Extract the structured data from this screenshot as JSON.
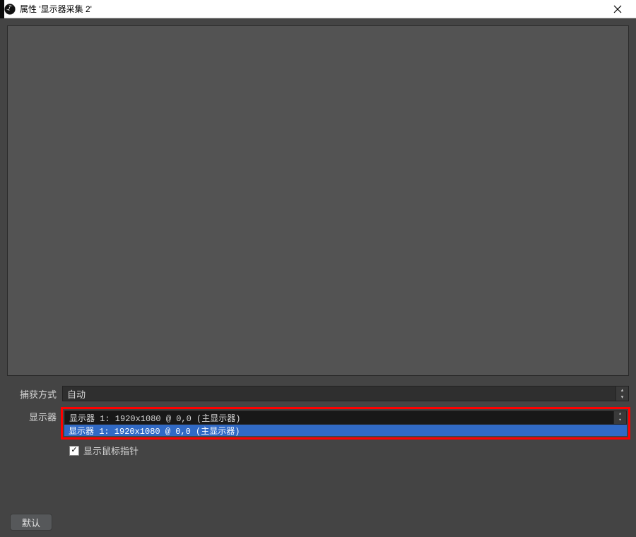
{
  "window": {
    "title": "属性 '显示器采集 2'"
  },
  "icons": {
    "app": "obs-icon",
    "close": "close-icon",
    "spinner_up": "▴",
    "spinner_down": "▾",
    "checkmark": "✓"
  },
  "form": {
    "capture_method": {
      "label": "捕获方式",
      "value": "自动"
    },
    "display": {
      "label": "显示器",
      "value": "显示器 1: 1920x1080 @ 0,0 (主显示器)",
      "dropdown_option": "显示器 1: 1920x1080 @ 0,0 (主显示器)"
    },
    "show_cursor": {
      "label": "显示鼠标指针",
      "checked": true
    }
  },
  "buttons": {
    "defaults": "默认"
  }
}
